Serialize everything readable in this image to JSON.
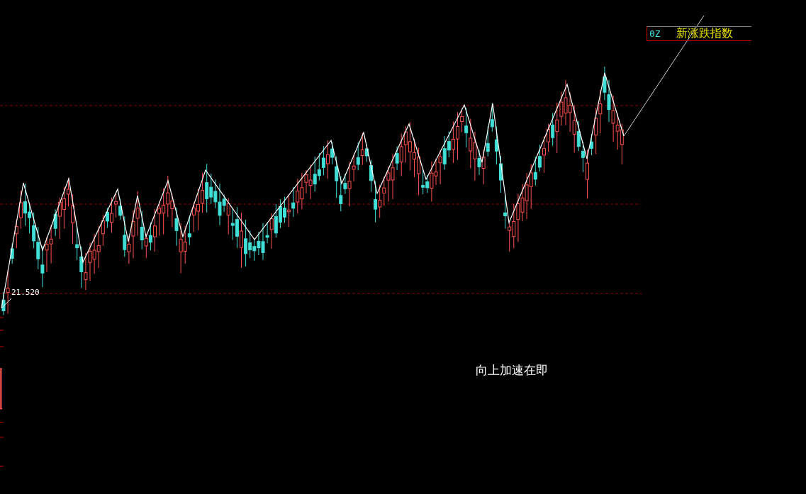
{
  "chart": {
    "price_label": "21.520",
    "caption": "向上加速在即"
  },
  "legend": {
    "code": "0Z",
    "name": "新涨跌指数"
  }
}
